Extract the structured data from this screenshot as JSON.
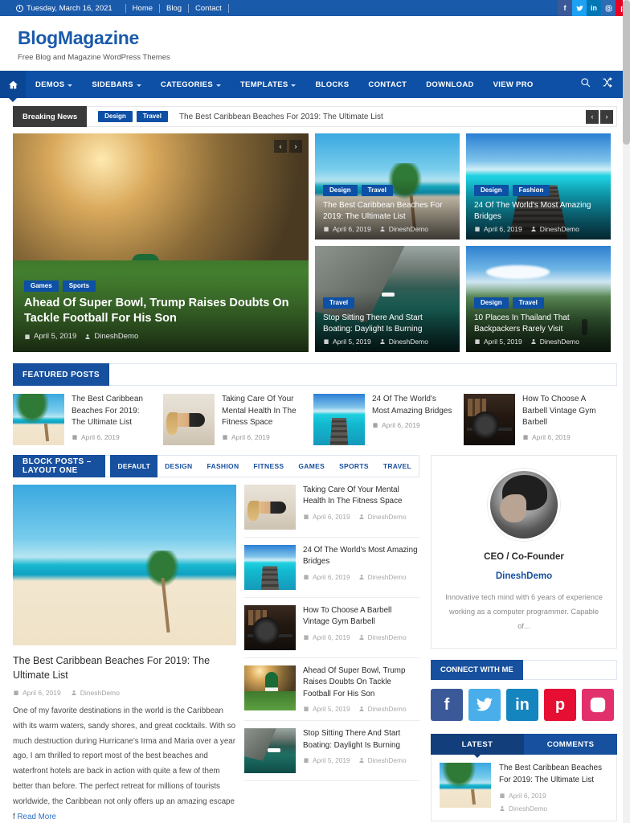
{
  "topbar": {
    "date": "Tuesday, March 16, 2021",
    "links": [
      "Home",
      "Blog",
      "Contact"
    ],
    "social": [
      {
        "name": "facebook-icon",
        "glyph": "f",
        "color": "#3b5998"
      },
      {
        "name": "twitter-icon",
        "glyph": "t",
        "color": "#1da1f2"
      },
      {
        "name": "linkedin-icon",
        "glyph": "in",
        "color": "#0077b5"
      },
      {
        "name": "instagram-icon",
        "glyph": "o",
        "color": "#2d6cb5"
      },
      {
        "name": "pinterest-icon",
        "glyph": "p",
        "color": "#e60023"
      }
    ]
  },
  "header": {
    "site_title": "BlogMagazine",
    "site_description": "Free Blog and Magazine WordPress Themes",
    "brand_color": "#1a5aab"
  },
  "nav": {
    "home_icon": "home-icon",
    "items": [
      {
        "label": "DEMOS",
        "caret": true
      },
      {
        "label": "SIDEBARS",
        "caret": true
      },
      {
        "label": "CATEGORIES",
        "caret": true
      },
      {
        "label": "TEMPLATES",
        "caret": true
      },
      {
        "label": "BLOCKS",
        "caret": false
      },
      {
        "label": "CONTACT",
        "caret": false
      },
      {
        "label": "DOWNLOAD",
        "caret": false
      },
      {
        "label": "VIEW PRO",
        "caret": false
      }
    ],
    "search_icon": "search-icon",
    "shuffle_icon": "random-icon"
  },
  "breaking": {
    "label": "Breaking News",
    "categories": [
      "Design",
      "Travel"
    ],
    "headline": "The Best Caribbean Beaches For 2019: The Ultimate List",
    "prev": "‹",
    "next": "›"
  },
  "hero": {
    "main": {
      "categories": [
        "Games",
        "Sports"
      ],
      "title": "Ahead Of Super Bowl, Trump Raises Doubts On Tackle Football For His Son",
      "date": "April 5, 2019",
      "author": "DineshDemo"
    },
    "cards": [
      {
        "categories": [
          "Design",
          "Travel"
        ],
        "title": "The Best Caribbean Beaches For 2019: The Ultimate List",
        "date": "April 6, 2019",
        "author": "DineshDemo"
      },
      {
        "categories": [
          "Design",
          "Fashion"
        ],
        "title": "24 Of The World's Most Amazing Bridges",
        "date": "April 6, 2019",
        "author": "DineshDemo"
      },
      {
        "categories": [
          "Travel"
        ],
        "title": "Stop Sitting There And Start Boating: Daylight Is Burning",
        "date": "April 5, 2019",
        "author": "DineshDemo"
      },
      {
        "categories": [
          "Design",
          "Travel"
        ],
        "title": "10 Places In Thailand That Backpackers Rarely Visit",
        "date": "April 5, 2019",
        "author": "DineshDemo"
      }
    ]
  },
  "featured": {
    "heading": "FEATURED POSTS",
    "posts": [
      {
        "title": "The Best Caribbean Beaches For 2019: The Ultimate List",
        "date": "April 6, 2019"
      },
      {
        "title": "Taking Care Of Your Mental Health In The Fitness Space",
        "date": "April 6, 2019"
      },
      {
        "title": "24 Of The World's Most Amazing Bridges",
        "date": "April 6, 2019"
      },
      {
        "title": "How To Choose A Barbell Vintage Gym Barbell",
        "date": "April 6, 2019"
      }
    ]
  },
  "block_posts": {
    "heading": "BLOCK POSTS – LAYOUT ONE",
    "tabs": [
      "DEFAULT",
      "DESIGN",
      "FASHION",
      "FITNESS",
      "GAMES",
      "SPORTS",
      "TRAVEL"
    ],
    "active_tab": "DEFAULT",
    "feature": {
      "title": "The Best Caribbean Beaches For 2019: The Ultimate List",
      "date": "April 6, 2019",
      "author": "DineshDemo",
      "excerpt": "One of my favorite destinations in the world is the Caribbean with its warm waters, sandy shores, and great cocktails. With so much destruction during Hurricane’s Irma and Maria over a year ago, I am thrilled to report most of the best beaches and waterfront hotels are back in action with quite a few of them better than before. The perfect retreat for millions of tourists worldwide, the Caribbean not only offers up an amazing escape f",
      "read_more": "Read More"
    },
    "list": [
      {
        "title": "Taking Care Of Your Mental Health In The Fitness Space",
        "date": "April 6, 2019",
        "author": "DineshDemo"
      },
      {
        "title": "24 Of The World's Most Amazing Bridges",
        "date": "April 6, 2019",
        "author": "DineshDemo"
      },
      {
        "title": "How To Choose A Barbell Vintage Gym Barbell",
        "date": "April 6, 2019",
        "author": "DineshDemo"
      },
      {
        "title": "Ahead Of Super Bowl, Trump Raises Doubts On Tackle Football For His Son",
        "date": "April 5, 2019",
        "author": "DineshDemo"
      },
      {
        "title": "Stop Sitting There And Start Boating: Daylight Is Burning",
        "date": "April 5, 2019",
        "author": "DineshDemo"
      }
    ]
  },
  "sidebar": {
    "about": {
      "role": "CEO / Co-Founder",
      "name": "DineshDemo",
      "bio": "Innovative tech mind with 6 years of experience working as a computer programmer. Capable of..."
    },
    "connect": {
      "heading": "CONNECT WITH ME",
      "social": [
        {
          "name": "facebook-icon",
          "color": "#3b5998"
        },
        {
          "name": "twitter-icon",
          "color": "#4aaeea"
        },
        {
          "name": "linkedin-icon",
          "color": "#1585bf"
        },
        {
          "name": "pinterest-icon",
          "color": "#e60f33"
        },
        {
          "name": "instagram-icon",
          "color": "#e1306c"
        }
      ]
    },
    "tabs": {
      "latest": "LATEST",
      "comments": "COMMENTS",
      "active": "LATEST"
    },
    "latest_post": {
      "title": "The Best Caribbean Beaches For 2019: The Ultimate List",
      "date": "April 6, 2019",
      "author": "DineshDemo"
    }
  }
}
